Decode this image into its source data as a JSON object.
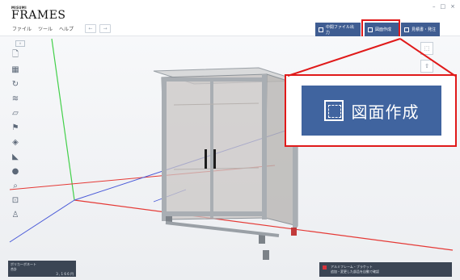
{
  "app": {
    "brand_small": "MISUMI",
    "brand_name": "FRAMES",
    "window_controls": [
      "–",
      "□",
      "×"
    ]
  },
  "menu": [
    "ファイル",
    "ツール",
    "ヘルプ"
  ],
  "toolbar": {
    "undo": "←",
    "redo": "→",
    "export_label": "中間ファイル出力",
    "drawing_label": "図面作成",
    "order_label": "見積書・発注"
  },
  "callout": {
    "label": "図面作成"
  },
  "status_left": {
    "line1": "ポリカーボネート",
    "line2": "合計",
    "value": "3 , 1 6 6 円"
  },
  "status_right": {
    "line1": "アルミフレーム・ブラケット",
    "line2": "追加・変更した部品を自動で確認"
  },
  "colors": {
    "accent": "#40649f",
    "highlight": "#e01a1a",
    "axis_x": "#e53935",
    "axis_y": "#43d04a",
    "axis_z": "#4a5ad8"
  },
  "icons": {
    "left_tools": [
      "new-file-icon",
      "frame-library-icon",
      "history-icon",
      "layers-icon",
      "panel-icon",
      "flag-icon",
      "part-icon",
      "bracket-icon",
      "fastener-icon",
      "zoom-icon",
      "fit-view-icon",
      "person-icon"
    ]
  }
}
